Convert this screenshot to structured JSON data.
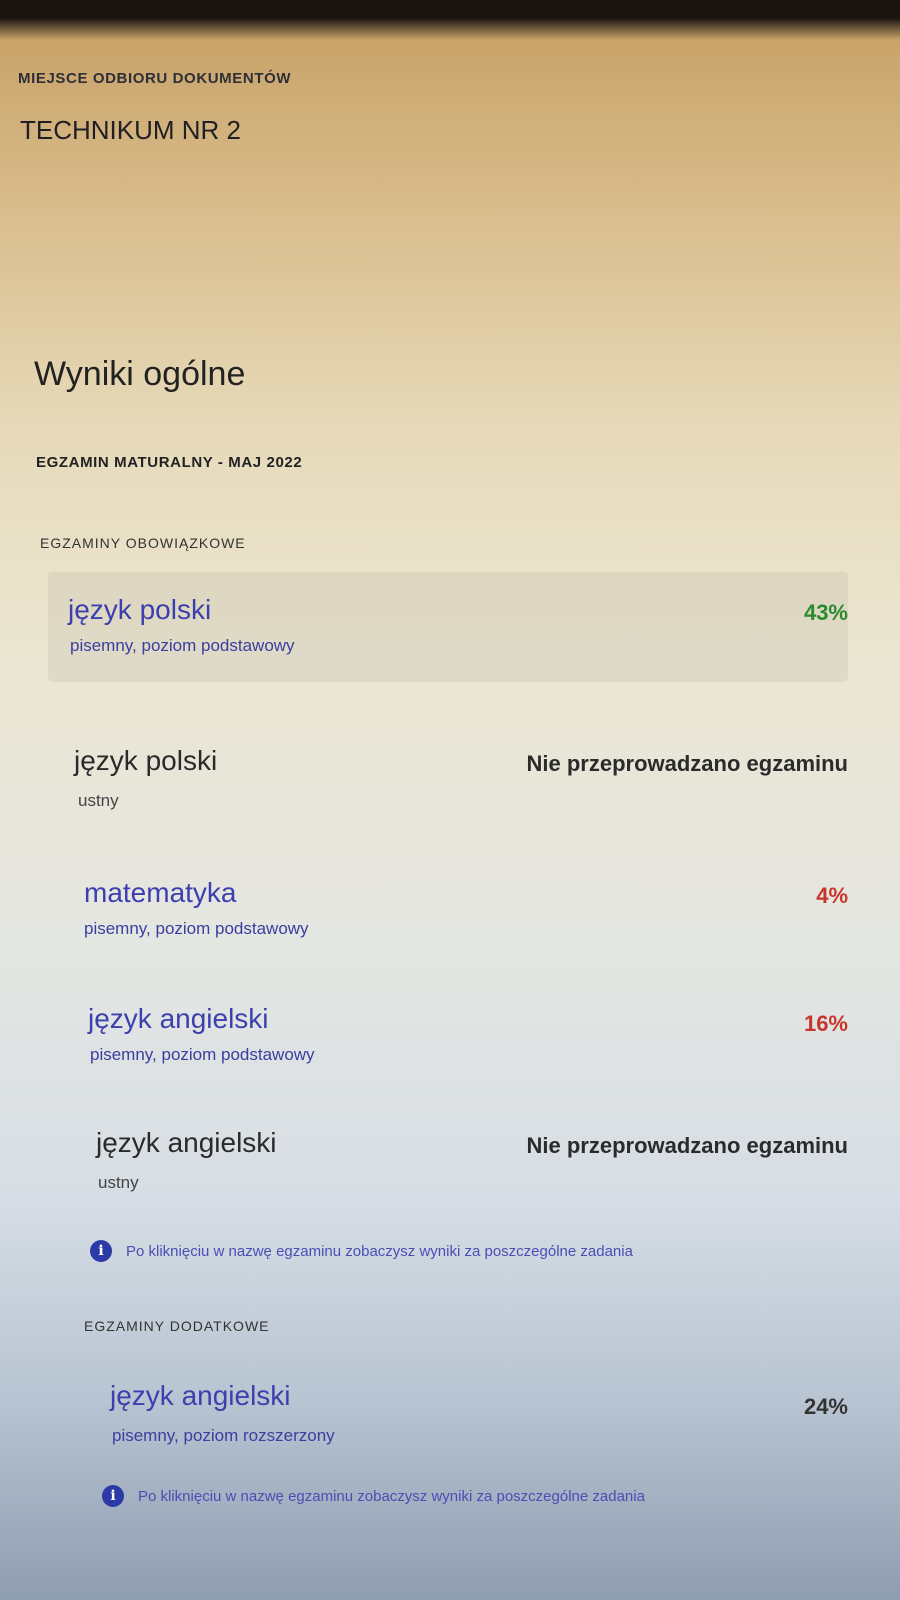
{
  "header": {
    "pickup_label": "MIEJSCE ODBIORU DOKUMENTÓW",
    "school": "TECHNIKUM NR 2"
  },
  "section_title": "Wyniki ogólne",
  "exam_title": "EGZAMIN MATURALNY - MAJ 2022",
  "mandatory": {
    "title": "EGZAMINY OBOWIĄZKOWE",
    "items": [
      {
        "subject": "język polski",
        "detail": "pisemny, poziom podstawowy",
        "result": "43%",
        "result_color": "#2a8a2e"
      },
      {
        "subject": "język polski",
        "detail": "ustny",
        "result": "Nie przeprowadzano egzaminu",
        "result_color": "#2b2b2b"
      },
      {
        "subject": "matematyka",
        "detail": "pisemny, poziom podstawowy",
        "result": "4%",
        "result_color": "#c7352b"
      },
      {
        "subject": "język angielski",
        "detail": "pisemny, poziom podstawowy",
        "result": "16%",
        "result_color": "#c7352b"
      },
      {
        "subject": "język angielski",
        "detail": "ustny",
        "result": "Nie przeprowadzano egzaminu",
        "result_color": "#2b2b2b"
      }
    ],
    "info": "Po kliknięciu w nazwę egzaminu zobaczysz wyniki za poszczególne zadania"
  },
  "additional": {
    "title": "EGZAMINY DODATKOWE",
    "items": [
      {
        "subject": "język angielski",
        "detail": "pisemny, poziom rozszerzony",
        "result": "24%",
        "result_color": "#333333"
      }
    ],
    "info": "Po kliknięciu w nazwę egzaminu zobaczysz wyniki za poszczególne zadania"
  },
  "icons": {
    "info": "info-icon"
  }
}
